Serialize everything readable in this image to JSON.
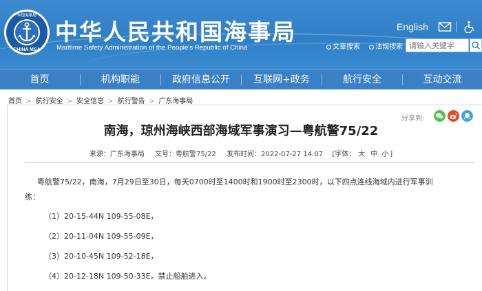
{
  "header": {
    "title_cn": "中华人民共和国海事局",
    "title_en": "Maritime Safety Administration of the People's Republic of China",
    "logo_text": "CHINA MSA",
    "logo_top_text": "中国海事局",
    "lang_link": "English",
    "icons": [
      "mail-icon",
      "accessibility-icon"
    ],
    "search": {
      "options": [
        "文章搜索",
        "法规搜索"
      ],
      "selected": "文章搜索",
      "placeholder": "请输入关键字"
    }
  },
  "nav": {
    "items": [
      {
        "label": "首页"
      },
      {
        "label": "机构职能"
      },
      {
        "label": "政府信息公开"
      },
      {
        "label": "互联网+政务"
      },
      {
        "label": "航行安全"
      },
      {
        "label": "互动交流"
      }
    ]
  },
  "breadcrumb": [
    "首页",
    "航行安全",
    "安全信息",
    "航行警告",
    "广东海事局"
  ],
  "breadcrumb_sep": ">",
  "share": {
    "label": "分享到:",
    "icons": [
      "wechat-icon",
      "weibo-icon",
      "qq-icon"
    ],
    "colors": [
      "#4cc54a",
      "#e6452c",
      "#3ba3e8"
    ]
  },
  "article": {
    "title": "南海，琼州海峡西部海域军事演习—粤航警75/22",
    "source": "来源：广东海事局",
    "doc_no": "文号：粤航警75/22",
    "publish_time": "发布时间：2022-07-27 14:07",
    "font_label": "[字体：",
    "font_sizes": [
      "大",
      "中",
      "小"
    ],
    "font_close": "]",
    "intro_line1": "粤航警75/22，南海，7月29日至30日，每天0700时至1400时和1900时至2300时，以下四点连线海域内进行军事训",
    "intro_line2": "练：",
    "points": [
      "（1）20-15-44N 109-55-08E，",
      "（2）20-11-04N 109-55-09E，",
      "（3）20-10-45N 109-52-18E，",
      "（4）20-12-18N 109-50-33E。禁止船舶进入。"
    ]
  }
}
